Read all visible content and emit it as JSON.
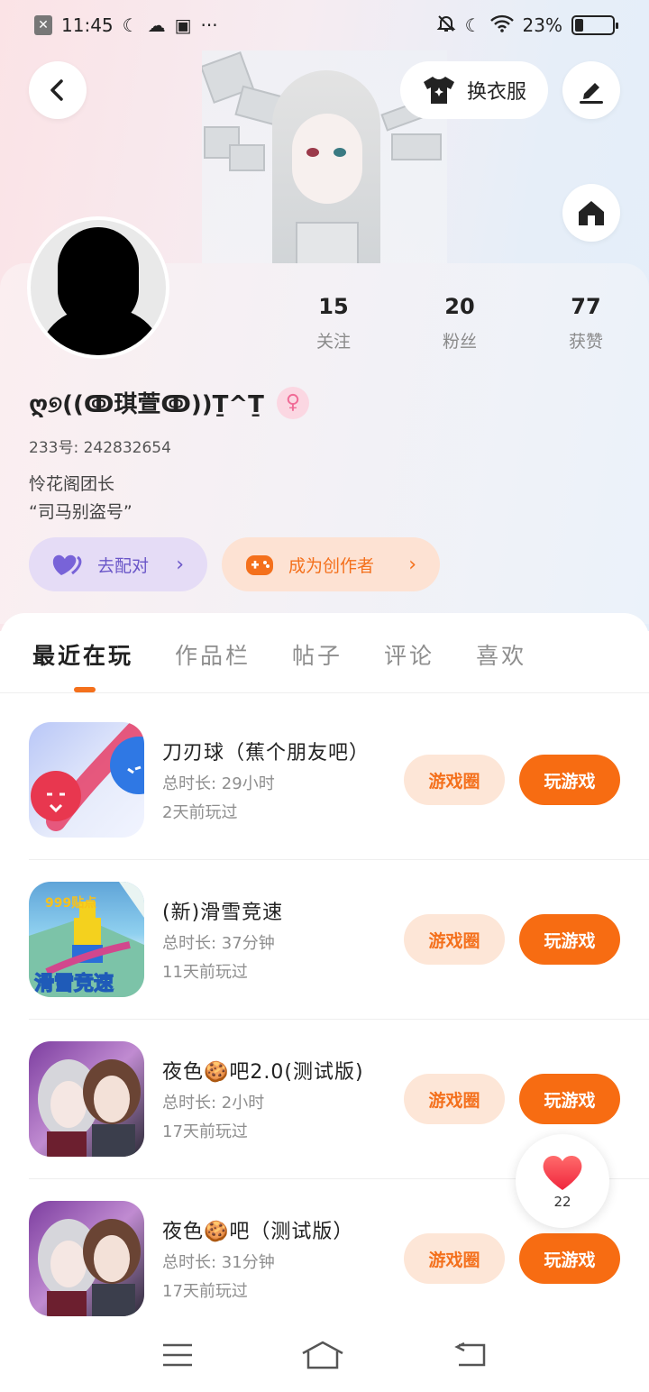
{
  "status_bar": {
    "time": "11:45",
    "battery_text": "23%",
    "battery_level": 0.23
  },
  "header": {
    "outfit_label": "换衣服"
  },
  "profile": {
    "nickname": "ღ୭((ↂ琪萱ↂ))Ṯ^Ṯ",
    "uid_text": "233号: 242832654",
    "bio_line1": "怜花阁团长",
    "bio_line2": "“司马别盗号”",
    "stats": [
      {
        "value": "15",
        "label": "关注"
      },
      {
        "value": "20",
        "label": "粉丝"
      },
      {
        "value": "77",
        "label": "获赞"
      }
    ],
    "pair_label": "去配对",
    "creator_label": "成为创作者"
  },
  "tabs": [
    "最近在玩",
    "作品栏",
    "帖子",
    "评论",
    "喜欢"
  ],
  "games": [
    {
      "title": "刀刃球（蕉个朋友吧）",
      "duration": "总时长: 29小时",
      "last_played": "2天前玩过",
      "circle_label": "游戏圈",
      "play_label": "玩游戏"
    },
    {
      "title": "(新)滑雪竞速",
      "duration": "总时长: 37分钟",
      "last_played": "11天前玩过",
      "circle_label": "游戏圈",
      "play_label": "玩游戏"
    },
    {
      "title": "夜色🍪吧2.0(测试版)",
      "duration": "总时长: 2小时",
      "last_played": "17天前玩过",
      "circle_label": "游戏圈",
      "play_label": "玩游戏"
    },
    {
      "title": "夜色🍪吧（测试版）",
      "duration": "总时长: 31分钟",
      "last_played": "17天前玩过",
      "circle_label": "游戏圈",
      "play_label": "玩游戏"
    }
  ],
  "game_icon_texts": {
    "ski_top": "999贴点",
    "ski_bottom": "滑雪竞速"
  },
  "like_float": {
    "count": "22"
  },
  "colors": {
    "accent": "#f76c12",
    "pair_purple": "#6a56c8",
    "gender_pink": "#f06b96"
  }
}
